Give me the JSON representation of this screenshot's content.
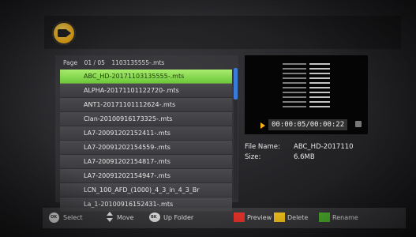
{
  "header": {
    "icon": "media-player-camera-icon"
  },
  "list": {
    "page_label": "Page",
    "page_value": "01 / 05",
    "current_file": "1103135555-.mts",
    "files": [
      "ABC_HD-20171103135555-.mts",
      "ALPHA-20171101122720-.mts",
      "ANT1-20171101112624-.mts",
      "Clan-20100916173325-.mts",
      "LA7-20091202152411-.mts",
      "LA7-20091202154559-.mts",
      "LA7-20091202154817-.mts",
      "LA7-20091202154947-.mts",
      "LCN_100_AFD_(1000)_4_3_in_4_3_Br",
      "La_1-20100916152431-.mts"
    ],
    "selected_index": 0,
    "scroll_fraction": 0.2
  },
  "preview": {
    "time": "00:00:05/00:00:22",
    "file_name_label": "File Name:",
    "file_name_value": "ABC_HD-2017110",
    "size_label": "Size:",
    "size_value": "6.6MB"
  },
  "footer": {
    "select": "Select",
    "move": "Move",
    "up_folder": "Up Folder",
    "preview": "Preview",
    "delete": "Delete",
    "rename": "Rename"
  },
  "colors": {
    "selection": "#8fdc55",
    "red_key": "#e0322a",
    "yellow_key": "#f2c21b",
    "green_key": "#4caf2c",
    "scroll": "#3b7bd8"
  }
}
